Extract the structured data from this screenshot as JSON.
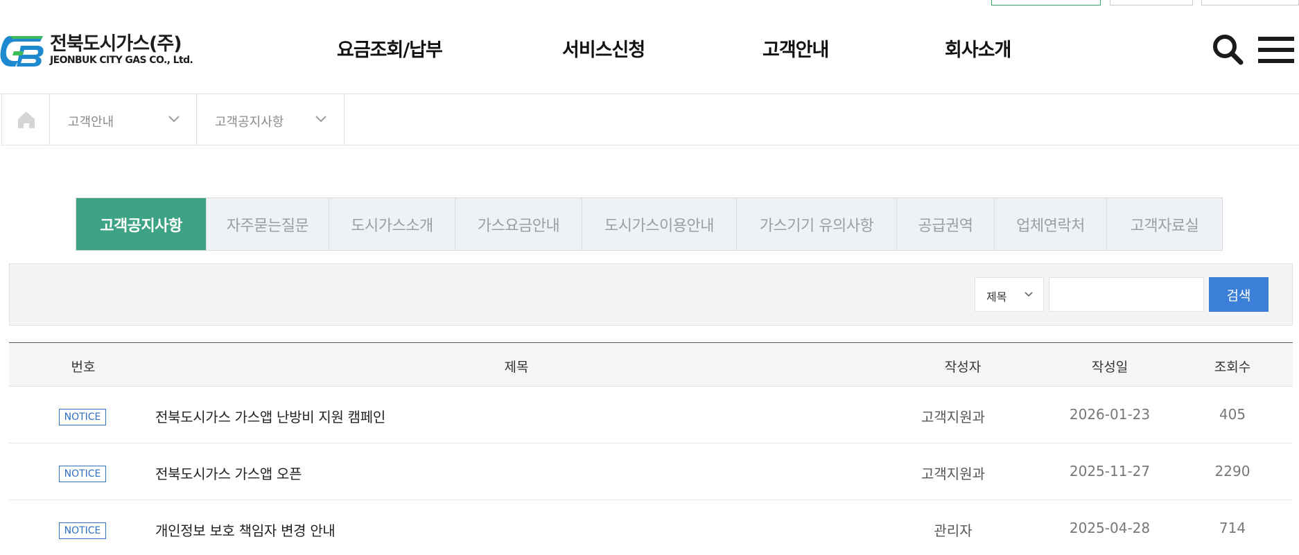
{
  "brand": {
    "name_ko": "전북도시가스(주)",
    "name_en": "JEONBUK CITY GAS CO., Ltd.",
    "colors": {
      "green": "#3ea385",
      "blue": "#3b7fd9",
      "logo_blue": "#1d8ad0",
      "logo_green": "#3fba5a"
    }
  },
  "gnb": [
    {
      "label": "요금조회/납부"
    },
    {
      "label": "서비스신청"
    },
    {
      "label": "고객안내"
    },
    {
      "label": "회사소개"
    }
  ],
  "header_icons": {
    "search": "search-icon",
    "menu": "hamburger-menu-icon"
  },
  "breadcrumb": {
    "home_icon": "home-icon",
    "items": [
      {
        "label": "고객안내"
      },
      {
        "label": "고객공지사항"
      }
    ]
  },
  "tabs": [
    {
      "label": "고객공지사항",
      "active": true
    },
    {
      "label": "자주묻는질문",
      "active": false
    },
    {
      "label": "도시가스소개",
      "active": false
    },
    {
      "label": "가스요금안내",
      "active": false
    },
    {
      "label": "도시가스이용안내",
      "active": false
    },
    {
      "label": "가스기기 유의사항",
      "active": false
    },
    {
      "label": "공급권역",
      "active": false
    },
    {
      "label": "업체연락처",
      "active": false
    },
    {
      "label": "고객자료실",
      "active": false
    }
  ],
  "search": {
    "field_selected": "제목",
    "keyword_value": "",
    "submit_label": "검색"
  },
  "table": {
    "headers": {
      "no": "번호",
      "subject": "제목",
      "author": "작성자",
      "date": "작성일",
      "views": "조회수"
    },
    "rows": [
      {
        "badge": "NOTICE",
        "subject": "전북도시가스 가스앱 난방비 지원 캠페인",
        "author": "고객지원과",
        "date": "2026-01-23",
        "views": "405"
      },
      {
        "badge": "NOTICE",
        "subject": "전북도시가스 가스앱 오픈",
        "author": "고객지원과",
        "date": "2025-11-27",
        "views": "2290"
      },
      {
        "badge": "NOTICE",
        "subject": "개인정보 보호 책임자 변경 안내",
        "author": "관리자",
        "date": "2025-04-28",
        "views": "714"
      }
    ]
  }
}
